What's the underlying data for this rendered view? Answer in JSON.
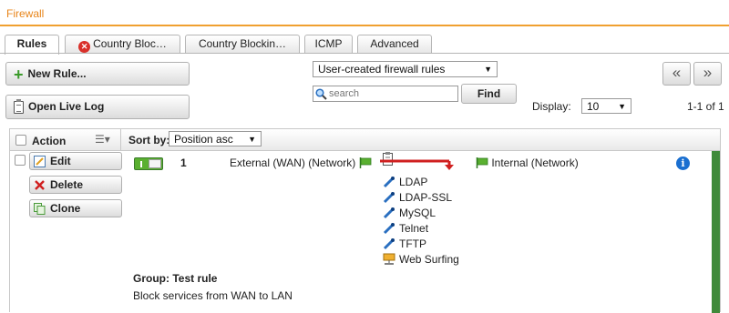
{
  "window": {
    "title": "Firewall"
  },
  "tabs": [
    {
      "label": "Rules"
    },
    {
      "label": "Country Bloc…"
    },
    {
      "label": "Country Blockin…"
    },
    {
      "label": "ICMP"
    },
    {
      "label": "Advanced"
    }
  ],
  "toolbar": {
    "new_rule_label": "New Rule...",
    "open_live_log_label": "Open Live Log",
    "filter_select_value": "User-created firewall rules",
    "search_placeholder": "search",
    "find_label": "Find",
    "display_label": "Display:",
    "display_value": "10",
    "page_info": "1-1 of 1",
    "prev_label": "«",
    "next_label": "»"
  },
  "grid": {
    "action_header": "Action",
    "sort_by_label": "Sort by:",
    "sort_value": "Position asc"
  },
  "rule": {
    "edit_label": "Edit",
    "delete_label": "Delete",
    "clone_label": "Clone",
    "position": "1",
    "source": "External (WAN) (Network)",
    "destination": "Internal (Network)",
    "services": [
      "LDAP",
      "LDAP-SSL",
      "MySQL",
      "Telnet",
      "TFTP",
      "Web Surfing"
    ],
    "group_label": "Group: Test rule",
    "comment": "Block services from WAN to LAN",
    "enabled": true
  },
  "colors": {
    "accent": "#e8851a",
    "status_green": "#3f8a3a",
    "block_red": "#d02020",
    "info_blue": "#1a6fd0"
  }
}
